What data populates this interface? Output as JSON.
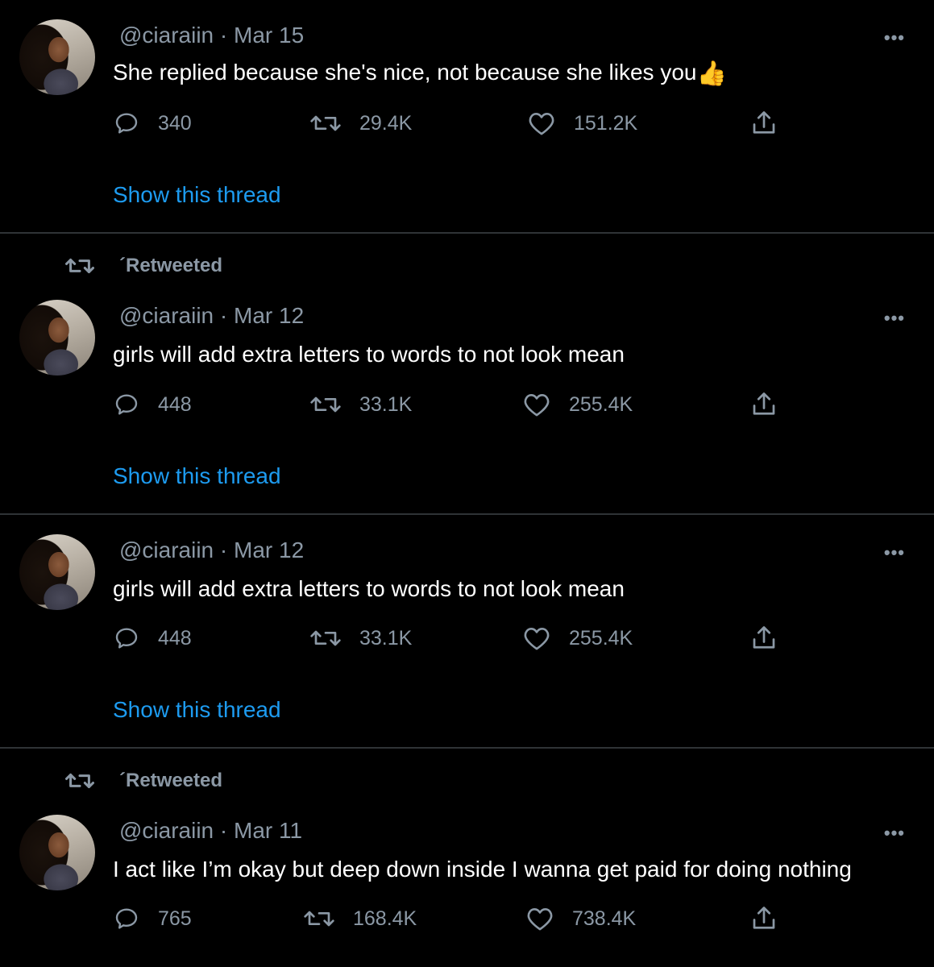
{
  "thread_link_label": "Show this thread",
  "more_label": "•••",
  "tweets": [
    {
      "handle": "@ciaraiin",
      "sep": "·",
      "date": "Mar 15",
      "text": "She replied because she's nice, not because she likes you",
      "emoji": "👍",
      "replies": "340",
      "retweets": "29.4K",
      "likes": "151.2K",
      "retweeted_label": ""
    },
    {
      "handle": "@ciaraiin",
      "sep": "·",
      "date": "Mar 12",
      "text": "girls will add extra letters to words to not look mean",
      "replies": "448",
      "retweets": "33.1K",
      "likes": "255.4K",
      "retweeted_label": "´Retweeted"
    },
    {
      "handle": "@ciaraiin",
      "sep": "·",
      "date": "Mar 12",
      "text": "girls will add extra letters to words to not look mean",
      "replies": "448",
      "retweets": "33.1K",
      "likes": "255.4K",
      "retweeted_label": ""
    },
    {
      "handle": "@ciaraiin",
      "sep": "·",
      "date": "Mar 11",
      "text": "I act like I’m okay but deep down inside I wanna get paid for doing nothing",
      "replies": "765",
      "retweets": "168.4K",
      "likes": "738.4K",
      "retweeted_label": "´Retweeted"
    }
  ],
  "icons": {
    "reply": "reply-icon",
    "retweet": "retweet-icon",
    "like": "heart-icon",
    "share": "share-icon"
  },
  "colors": {
    "background": "#000000",
    "text": "#ffffff",
    "muted": "#8b98a5",
    "link": "#1d9bf0",
    "divider": "#2f3336"
  }
}
